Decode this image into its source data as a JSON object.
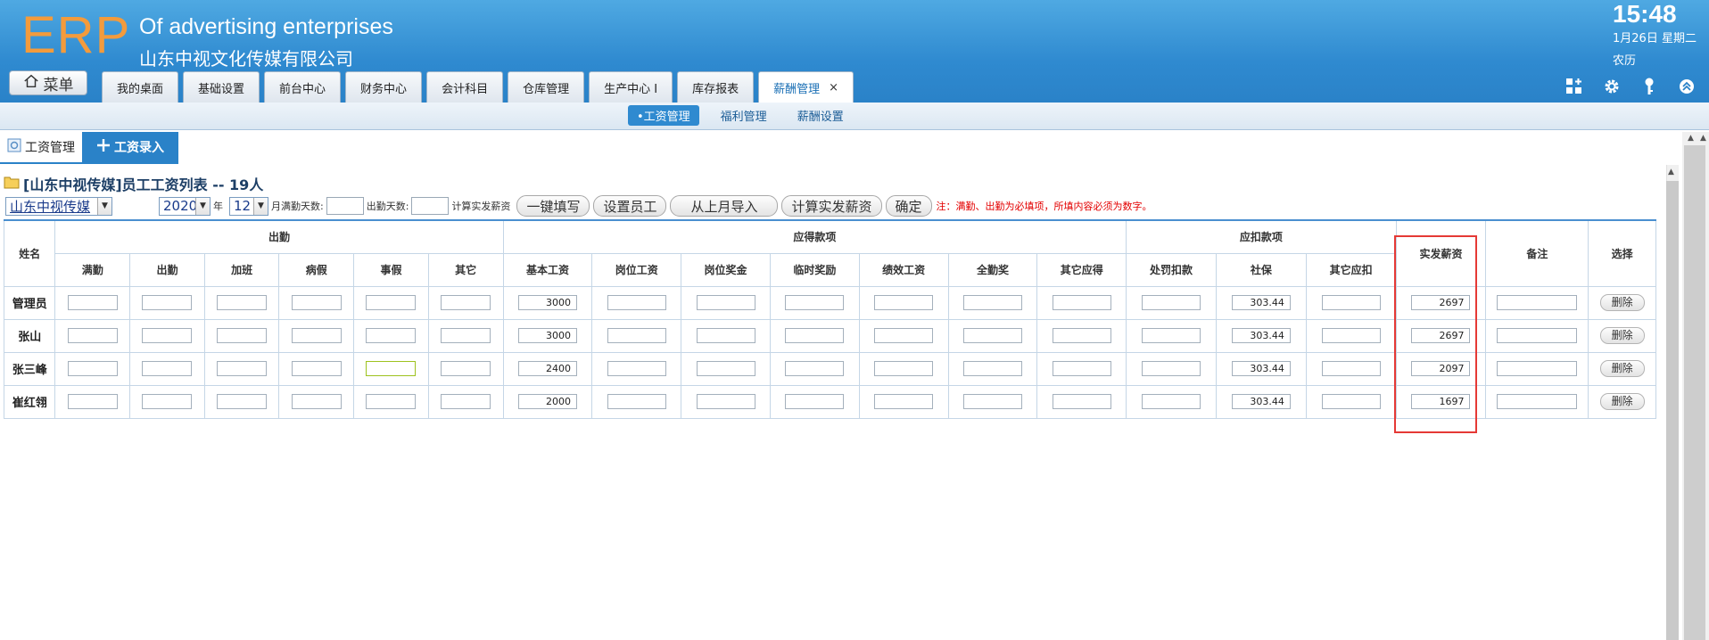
{
  "header": {
    "logo": "ERP",
    "app_name_en": "Of advertising enterprises",
    "company": "山东中视文化传媒有限公司",
    "time": "15:48",
    "date": "1月26日 星期二",
    "lunar": "农历",
    "menu_label": "菜单",
    "brand_color": "#2a82c8",
    "logo_color": "#f39b3c"
  },
  "nav_tabs": [
    {
      "label": "我的桌面"
    },
    {
      "label": "基础设置"
    },
    {
      "label": "前台中心"
    },
    {
      "label": "财务中心"
    },
    {
      "label": "会计科目"
    },
    {
      "label": "仓库管理"
    },
    {
      "label": "生产中心 I"
    },
    {
      "label": "库存报表"
    },
    {
      "label": "薪酬管理",
      "active": true,
      "close": "×"
    }
  ],
  "header_icons": [
    "add-widget-icon",
    "gear-icon",
    "key-icon",
    "collapse-up-icon"
  ],
  "subnav": [
    {
      "label": "•工资管理",
      "active": true
    },
    {
      "label": "福利管理"
    },
    {
      "label": "薪酬设置"
    }
  ],
  "content_tabs": {
    "manage": "工资管理",
    "entry": "工资录入"
  },
  "list_title": "[山东中视传媒]员工工资列表 -- 19人",
  "toolbar": {
    "company_select": "山东中视传媒",
    "year": "2020",
    "year_unit": "年",
    "month": "12",
    "month_label": "月满勤天数:",
    "attend_label": "出勤天数:",
    "calc_label": "计算实发薪资",
    "btn_fill": "一键填写",
    "btn_set_staff": "设置员工",
    "btn_import": "从上月导入",
    "btn_calc": "计算实发薪资",
    "btn_confirm": "确定",
    "note": "注：满勤、出勤为必填项，所填内容必须为数字。"
  },
  "table": {
    "col_name": "姓名",
    "group_attendance": "出勤",
    "group_payable": "应得款项",
    "group_deduction": "应扣款项",
    "col_net": "实发薪资",
    "col_remark": "备注",
    "col_select": "选择",
    "attendance_cols": [
      "满勤",
      "出勤",
      "加班",
      "病假",
      "事假",
      "其它"
    ],
    "payable_cols": [
      "基本工资",
      "岗位工资",
      "岗位奖金",
      "临时奖励",
      "绩效工资",
      "全勤奖",
      "其它应得"
    ],
    "deduction_cols": [
      "处罚扣款",
      "社保",
      "其它应扣"
    ],
    "delete_label": "删除",
    "rows": [
      {
        "name": "管理员",
        "basic": "3000",
        "social": "303.44",
        "net": "2697"
      },
      {
        "name": "张山",
        "basic": "3000",
        "social": "303.44",
        "net": "2697"
      },
      {
        "name": "张三峰",
        "basic": "2400",
        "social": "303.44",
        "net": "2097"
      },
      {
        "name": "崔红翎",
        "basic": "2000",
        "social": "303.44",
        "net": "1697"
      }
    ]
  }
}
